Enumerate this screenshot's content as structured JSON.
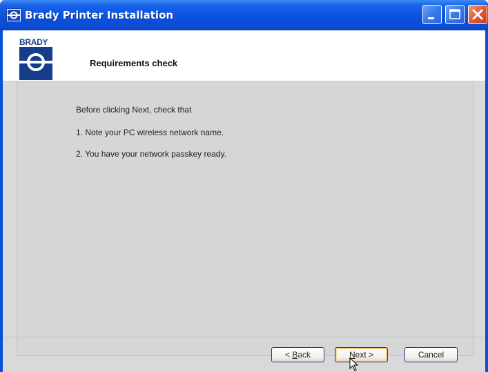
{
  "window": {
    "title": "Brady Printer Installation",
    "title_bar_color": "#0a52df",
    "close_button_color": "#e25f35"
  },
  "header": {
    "logo_text": "BRADY",
    "logo_color": "#163c8c",
    "title": "Requirements check"
  },
  "content": {
    "lines": [
      "Before clicking Next, check that",
      "1. Note your PC wireless network name.",
      "2. You have your network passkey ready."
    ]
  },
  "buttons": {
    "back": {
      "prefix": "< ",
      "mnemonic": "B",
      "rest": "ack"
    },
    "next": {
      "mnemonic": "N",
      "rest": "ext >"
    },
    "cancel": {
      "label": "Cancel"
    }
  },
  "icons": {
    "title_icon": "brady-logo-icon",
    "minimize": "minimize-icon",
    "maximize": "maximize-icon",
    "close": "close-icon",
    "cursor": "mouse-pointer-icon"
  }
}
